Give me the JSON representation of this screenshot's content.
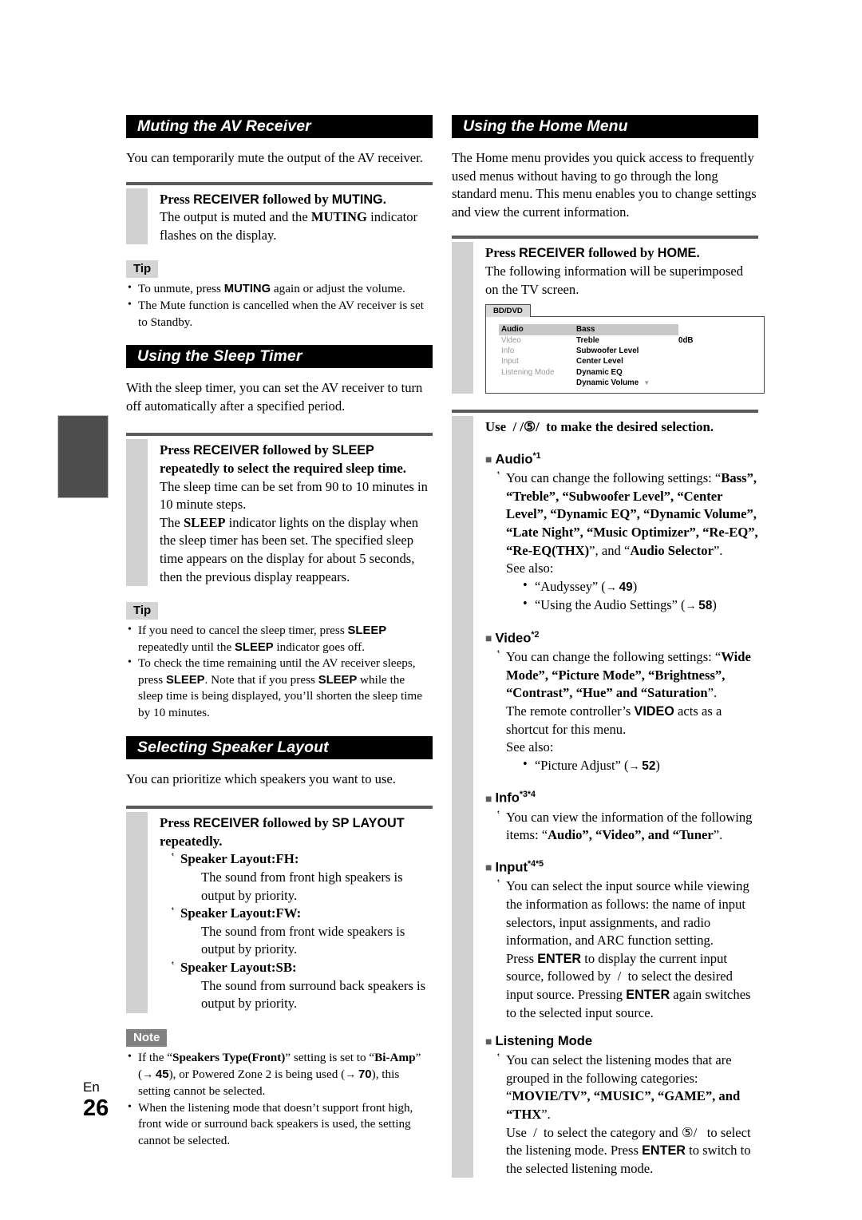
{
  "page": {
    "language_label": "En",
    "number": "26"
  },
  "left_column": {
    "section_muting": {
      "heading": "Muting the AV Receiver",
      "intro": "You can temporarily mute the output of the AV receiver.",
      "step": {
        "lead_pre": "Press ",
        "lead_key1": "RECEIVER",
        "lead_mid": " followed by ",
        "lead_key2": "MUTING.",
        "body_pre": "The output is muted and the ",
        "body_key": "MUTING",
        "body_post": " indicator flashes on the display."
      },
      "tip_badge": "Tip",
      "tips": [
        {
          "pre": "To unmute, press ",
          "key": "MUTING",
          "post": " again or adjust the volume."
        },
        {
          "pre": "The Mute function is cancelled when the AV receiver is set to Standby.",
          "key": "",
          "post": ""
        }
      ]
    },
    "section_sleep": {
      "heading": "Using the Sleep Timer",
      "intro": "With the sleep timer, you can set the AV receiver to turn off automatically after a specified period.",
      "step": {
        "lead_pre": "Press ",
        "lead_key1": "RECEIVER",
        "lead_mid": " followed by ",
        "lead_key2": "SLEEP",
        "lead_post": " repeatedly to select the required sleep time.",
        "para1": "The sleep time can be set from 90 to 10 minutes in 10 minute steps.",
        "para2_pre": "The ",
        "para2_key": "SLEEP",
        "para2_post": " indicator lights on the display when the sleep timer has been set. The specified sleep time appears on the display for about 5 seconds, then the previous display reappears."
      },
      "tip_badge": "Tip",
      "tips": [
        {
          "a": "If you need to cancel the sleep timer, press ",
          "k1": "SLEEP",
          "b": " repeatedly until the ",
          "k2": "SLEEP",
          "c": " indicator goes off."
        },
        {
          "a": "To check the time remaining until the AV receiver sleeps, press ",
          "k1": "SLEEP",
          "b": ". Note that if you press ",
          "k2": "SLEEP",
          "c": " while the sleep time is being displayed, you’ll shorten the sleep time by 10 minutes."
        }
      ]
    },
    "section_speaker": {
      "heading": "Selecting Speaker Layout",
      "intro": "You can prioritize which speakers you want to use.",
      "step": {
        "lead_pre": "Press ",
        "lead_key1": "RECEIVER",
        "lead_mid": " followed by ",
        "lead_key2": "SP LAYOUT",
        "lead_post": " repeatedly."
      },
      "layouts": [
        {
          "term": "Speaker Layout:FH",
          "desc": "The sound from front high speakers is output by priority."
        },
        {
          "term": "Speaker Layout:FW",
          "desc": "The sound from front wide speakers is output by priority."
        },
        {
          "term": "Speaker Layout:SB",
          "desc": "The sound from surround back speakers is output by priority."
        }
      ],
      "note_badge": "Note",
      "notes": [
        {
          "a": "If the “",
          "k1": "Speakers Type(Front)",
          "b": "” setting is set to “",
          "k2": "Bi-Amp",
          "c": "” (",
          "p1": "45",
          "d": "), or Powered Zone 2 is being used (",
          "p2": "70",
          "e": "), this setting cannot be selected."
        },
        {
          "a": "When the listening mode that doesn’t support front high, front wide or surround back speakers is used, the setting cannot be selected.",
          "k1": "",
          "b": "",
          "k2": "",
          "c": "",
          "p1": "",
          "d": "",
          "p2": "",
          "e": ""
        }
      ]
    }
  },
  "right_column": {
    "section_home": {
      "heading": "Using the Home Menu",
      "intro": "The Home menu provides you quick access to frequently used menus without having to go through the long standard menu. This menu enables you to change settings and view the current information.",
      "step": {
        "lead_pre": "Press ",
        "lead_key1": "RECEIVER",
        "lead_mid": " followed by ",
        "lead_key2": "HOME.",
        "body": "The following information will be superimposed on the TV screen."
      }
    },
    "tv_screen": {
      "tab_label": "BD/DVD",
      "left_menu": [
        "Audio",
        "Video",
        "Info",
        "Input",
        "Listening Mode"
      ],
      "left_menu_selected": "Audio",
      "items": [
        "Bass",
        "Treble",
        "Subwoofer Level",
        "Center Level",
        "Dynamic EQ",
        "Dynamic Volume"
      ],
      "items_selected": "Bass",
      "value": "0dB",
      "value_row": "Treble",
      "scroll_caret": "▼"
    },
    "use_step": {
      "lead_pre": "Use ",
      "lead_sep1": "/",
      "lead_sep2": "/",
      "lead_circle": "⑤",
      "lead_sep3": "/",
      "lead_post": "to make the desired selection."
    },
    "subsections": [
      {
        "title": "Audio",
        "sup": "*1",
        "tick_pre": "You can change the following settings: “",
        "tick_bold": "Bass”, “Treble”, “Subwoofer Level”, “Center Level”, “Dynamic EQ”, “Dynamic Volume”, “Late Night”, “Music Optimizer”, “Re-EQ”, “Re-EQ(THX)",
        "tick_post": "”, and “",
        "tick_bold2": "Audio Selector",
        "tick_end": "”.",
        "see_also_label": "See also:",
        "see_also": [
          {
            "text": "“Audyssey” (",
            "page": "49",
            "close": ")"
          },
          {
            "text": "“Using the Audio Settings” (",
            "page": "58",
            "close": ")"
          }
        ]
      },
      {
        "title": "Video",
        "sup": "*2",
        "tick_pre": "You can change the following settings: “",
        "tick_bold": "Wide Mode”, “Picture Mode”, “Brightness”, “Contrast”, “Hue” and “Saturation",
        "tick_end": "”.",
        "extra_pre": "The remote controller’s ",
        "extra_key": "VIDEO",
        "extra_post": " acts as a shortcut for this menu.",
        "see_also_label": "See also:",
        "see_also": [
          {
            "text": "“Picture Adjust” (",
            "page": "52",
            "close": ")"
          }
        ]
      },
      {
        "title": "Info",
        "sup": "*3*4",
        "tick_pre": "You can view the information of the following items: “",
        "tick_bold": "Audio”, “Video”, and “Tuner",
        "tick_end": "”."
      },
      {
        "title": "Input",
        "sup": "*4*5",
        "tick_pre": "You can select the input source while viewing the information as follows: the name of input selectors, input assignments, and radio information, and ARC function setting.",
        "p_a": "Press ",
        "p_k1": "ENTER",
        "p_b": " to display the current input source, followed by ",
        "p_sep": "/",
        "p_c": " to select the desired input source. Pressing ",
        "p_k2": "ENTER",
        "p_d": " again switches to the selected input source."
      },
      {
        "title": "Listening Mode",
        "sup": "",
        "tick_pre": "You can select the listening modes that are grouped in the following categories: “",
        "tick_bold": "MOVIE/TV”, “MUSIC”, “GAME”, and “THX",
        "tick_end": "”.",
        "p_a": "Use ",
        "p_sep1": "/",
        "p_b": " to select the category and ",
        "p_circle": "⑤",
        "p_sep2": "/",
        "p_c": " to select the listening mode. Press ",
        "p_k2": "ENTER",
        "p_d": " to switch to the selected listening mode."
      }
    ]
  }
}
